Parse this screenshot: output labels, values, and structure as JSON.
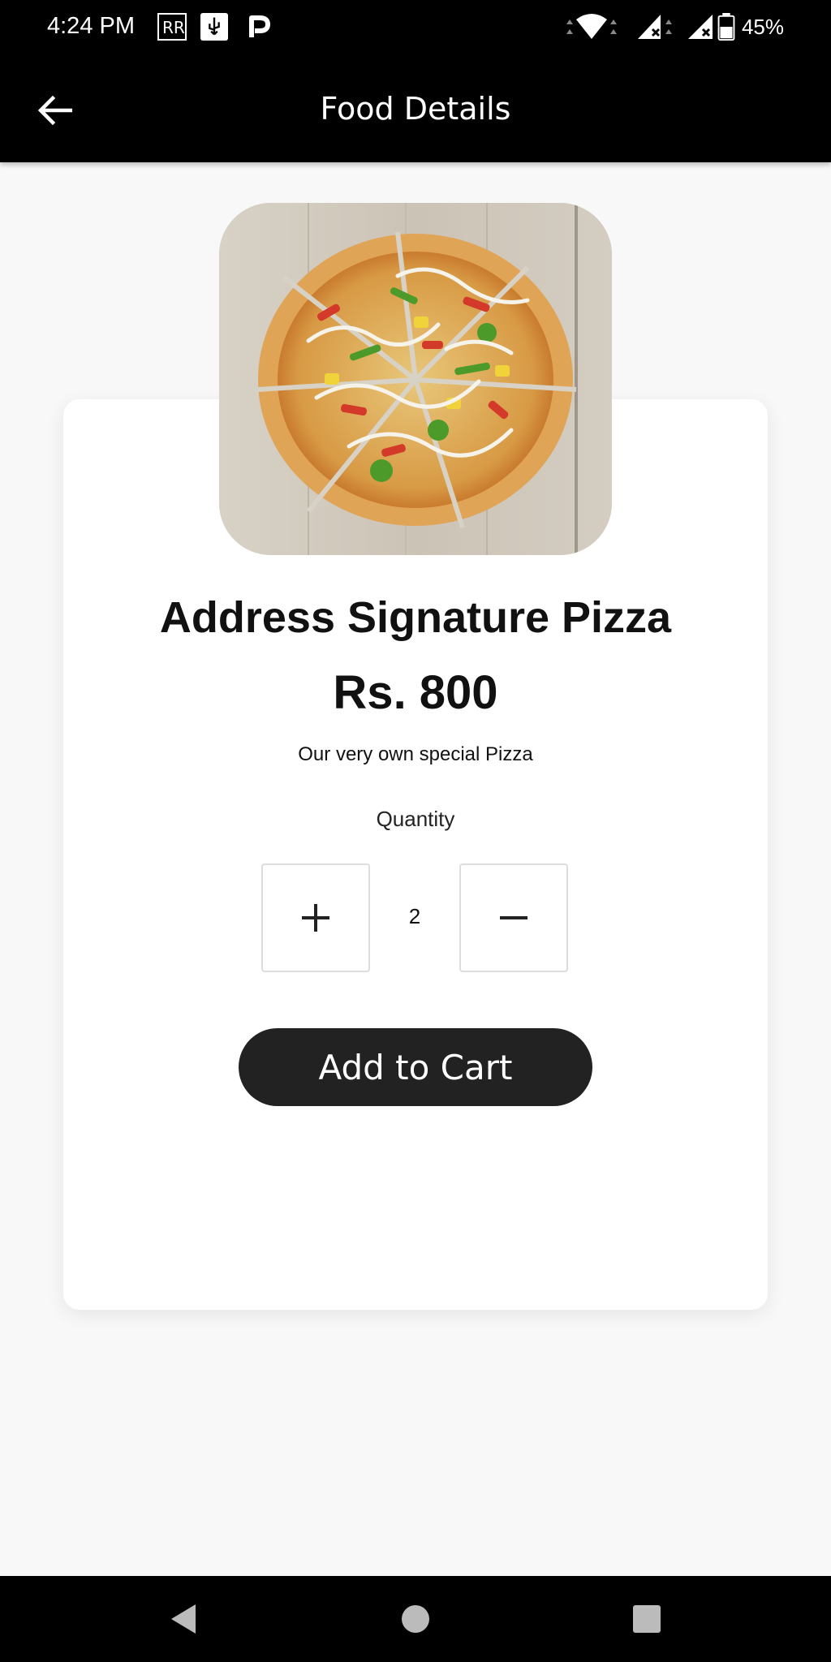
{
  "status_bar": {
    "time": "4:24 PM",
    "battery": "45%",
    "icons": [
      "rr-icon",
      "usb-icon",
      "parking-icon",
      "wifi-icon",
      "signal-icon",
      "signal-icon",
      "battery-icon"
    ]
  },
  "app_bar": {
    "title": "Food Details",
    "back_icon": "arrow-left-icon"
  },
  "food": {
    "name": "Address Signature Pizza",
    "price": "Rs. 800",
    "description": "Our very own special Pizza",
    "image": "pizza-photo"
  },
  "quantity": {
    "label": "Quantity",
    "value": "2",
    "increment_icon": "plus-icon",
    "decrement_icon": "minus-icon"
  },
  "actions": {
    "add_to_cart": "Add to Cart"
  },
  "nav": {
    "icons": [
      "back-triangle-icon",
      "home-circle-icon",
      "recents-square-icon"
    ]
  },
  "colors": {
    "app_bar": "#000000",
    "button": "#222222",
    "background": "#f8f8f8"
  }
}
